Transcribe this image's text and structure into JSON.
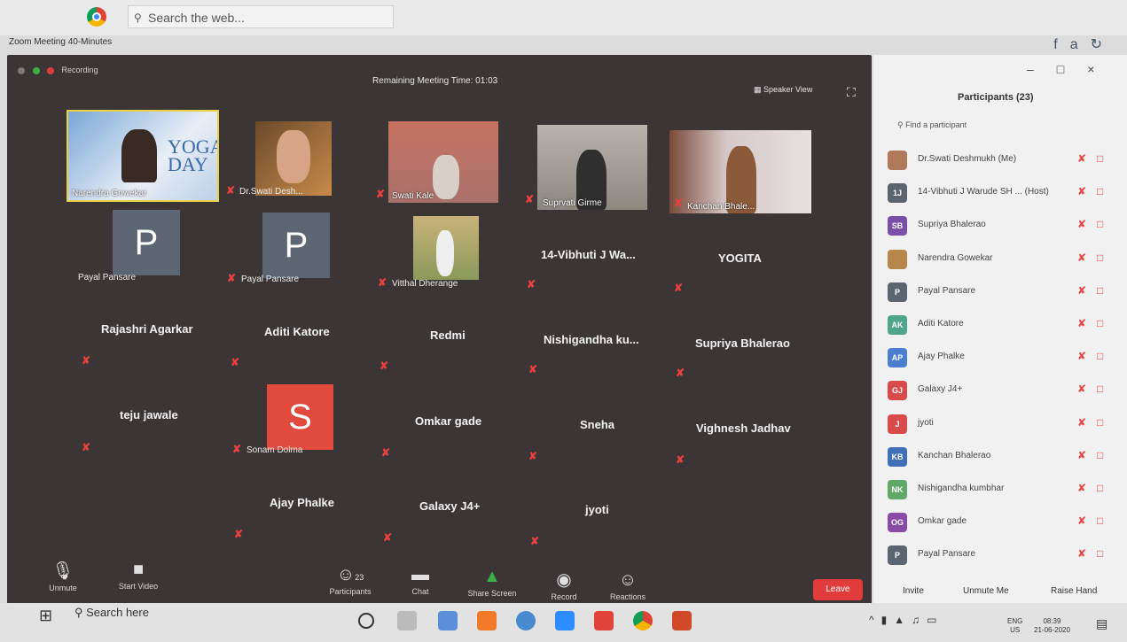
{
  "browser": {
    "search_placeholder": "Search the web..."
  },
  "window": {
    "title": "Zoom Meeting 40-Minutes"
  },
  "meeting": {
    "recording_label": "Recording",
    "remaining_time": "Remaining Meeting Time: 01:03",
    "speaker_view": "Speaker View"
  },
  "tiles": {
    "video": [
      "Narendra Gowekar",
      "Dr.Swati Desh...",
      "Swati Kale",
      "Suprvati Girme",
      "Kanchan Bhale..."
    ],
    "payal1_letter": "P",
    "payal1_name": "Payal Pansare",
    "payal2_letter": "P",
    "payal2_name": "Payal Pansare",
    "vitthal": "Vitthal Dherange",
    "name_only": [
      "14-Vibhuti J Wa...",
      "YOGITA",
      "Rajashri Agarkar",
      "Aditi Katore",
      "Redmi",
      "Nishigandha ku...",
      "Supriya Bhalerao",
      "teju jawale",
      "Omkar gade",
      "Sneha",
      "Vighnesh Jadhav",
      "Ajay Phalke",
      "Galaxy J4+",
      "jyoti"
    ],
    "sonam_letter": "S",
    "sonam_name": "Sonam Dolma",
    "yoga_text": "YOGA DAY"
  },
  "toolbar": {
    "unmute": "Unmute",
    "start_video": "Start Video",
    "participants": "Participants",
    "participants_count": "23",
    "chat": "Chat",
    "share_screen": "Share Screen",
    "record": "Record",
    "reactions": "Reactions",
    "leave": "Leave"
  },
  "panel": {
    "title": "Participants (23)",
    "find_placeholder": "Find a participant",
    "invite": "Invite",
    "unmute_me": "Unmute Me",
    "raise_hand": "Raise Hand",
    "participants": [
      {
        "initials": "",
        "name": "Dr.Swati Deshmukh (Me)",
        "color": "#b07a5a"
      },
      {
        "initials": "1J",
        "name": "14-Vibhuti J Warude SH ... (Host)",
        "color": "#5b6570"
      },
      {
        "initials": "SB",
        "name": "Supriya Bhalerao",
        "color": "#7a4fa8"
      },
      {
        "initials": "",
        "name": "Narendra Gowekar",
        "color": "#b7864a"
      },
      {
        "initials": "P",
        "name": "Payal Pansare",
        "color": "#5c6673"
      },
      {
        "initials": "AK",
        "name": "Aditi Katore",
        "color": "#4ea58a"
      },
      {
        "initials": "AP",
        "name": "Ajay Phalke",
        "color": "#4a7fd0"
      },
      {
        "initials": "GJ",
        "name": "Galaxy J4+",
        "color": "#d94b4b"
      },
      {
        "initials": "J",
        "name": "jyoti",
        "color": "#d94b4b"
      },
      {
        "initials": "KB",
        "name": "Kanchan Bhalerao",
        "color": "#3f6fb8"
      },
      {
        "initials": "NK",
        "name": "Nishigandha kumbhar",
        "color": "#5fa86a"
      },
      {
        "initials": "OG",
        "name": "Omkar gade",
        "color": "#8a4aa8"
      },
      {
        "initials": "P",
        "name": "Payal Pansare",
        "color": "#5c6673"
      }
    ]
  },
  "taskbar": {
    "search": "Search here",
    "lang": "ENG",
    "region": "US",
    "time": "08:39",
    "date": "21-06-2020"
  }
}
